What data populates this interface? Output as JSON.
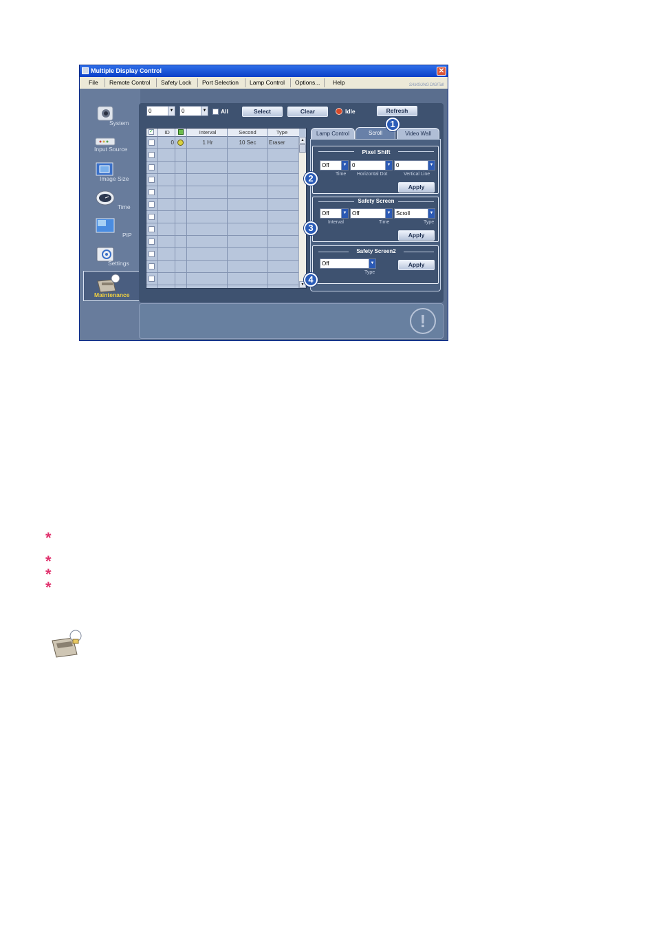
{
  "window": {
    "title": "Multiple Display Control",
    "close_glyph": "✕"
  },
  "menu": {
    "items": [
      "File",
      "Remote Control",
      "Safety Lock",
      "Port Selection",
      "Lamp Control",
      "Options...",
      "Help"
    ],
    "brand": "SAMSUNG DIGITall"
  },
  "sidebar": {
    "items": [
      {
        "label": "System",
        "icon": "camera-icon"
      },
      {
        "label": "Input Source",
        "icon": "input-source-icon"
      },
      {
        "label": "Image Size",
        "icon": "image-size-icon"
      },
      {
        "label": "Time",
        "icon": "clock-icon"
      },
      {
        "label": "PIP",
        "icon": "pip-icon"
      },
      {
        "label": "Settings",
        "icon": "settings-icon"
      },
      {
        "label": "Maintenance",
        "icon": "maintenance-icon",
        "selected": true
      }
    ]
  },
  "toolbar": {
    "id_from": "0",
    "id_to": "0",
    "all_label": "All",
    "select_label": "Select",
    "clear_label": "Clear",
    "status_label": "Idle",
    "refresh_label": "Refresh"
  },
  "grid": {
    "columns": [
      "ID",
      "Interval",
      "Second",
      "Type"
    ],
    "rows": [
      {
        "id": "0",
        "interval": "1 Hr",
        "second": "10 Sec",
        "type": "Eraser"
      }
    ],
    "empty_rows": 11
  },
  "tabs": {
    "items": [
      "Lamp Control",
      "Scroll",
      "Video Wall"
    ],
    "active": "Scroll"
  },
  "pixel_shift": {
    "title": "Pixel Shift",
    "time_value": "Off",
    "time_caption": "Time",
    "hdot_value": "0",
    "hdot_caption": "Horizontal Dot",
    "vline_value": "0",
    "vline_caption": "Vertical Line",
    "apply_label": "Apply"
  },
  "safety_screen": {
    "title": "Safety Screen",
    "interval_value": "Off",
    "interval_caption": "Interval",
    "time_value": "Off",
    "time_caption": "Time",
    "type_value": "Scroll",
    "type_caption": "Type",
    "apply_label": "Apply"
  },
  "safety_screen2": {
    "title": "Safety Screen2",
    "type_value": "Off",
    "type_caption": "Type",
    "apply_label": "Apply"
  },
  "badges": [
    "1",
    "2",
    "3",
    "4"
  ],
  "status_icon": "!",
  "notes": {
    "asterisk": "*"
  },
  "colors": {
    "titlebar": "#0a3fc8",
    "panel": "#3e5270",
    "badge": "#2b5cb8",
    "asterisk": "#e0306c",
    "status_led": "#d84a2a"
  }
}
